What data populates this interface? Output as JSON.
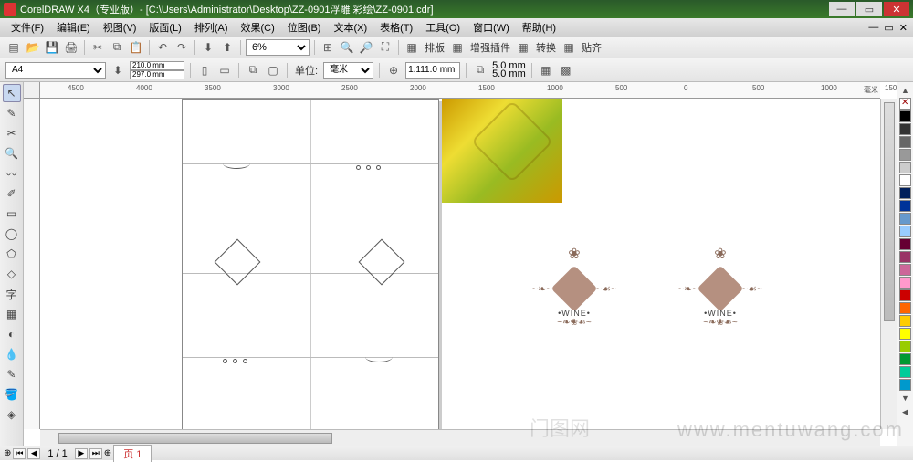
{
  "window": {
    "title": "CorelDRAW X4（专业版）- [C:\\Users\\Administrator\\Desktop\\ZZ-0901浮雕 彩绘\\ZZ-0901.cdr]"
  },
  "menubar": [
    "文件(F)",
    "编辑(E)",
    "视图(V)",
    "版面(L)",
    "排列(A)",
    "效果(C)",
    "位图(B)",
    "文本(X)",
    "表格(T)",
    "工具(O)",
    "窗口(W)",
    "帮助(H)"
  ],
  "toolbar1": {
    "zoom_value": "6%",
    "panel_layout": "排版",
    "panel_plugin": "增强插件",
    "panel_convert": "转换",
    "panel_align": "贴齐"
  },
  "propbar": {
    "paper": "A4",
    "width": "210.0 mm",
    "height": "297.0 mm",
    "units_label": "单位:",
    "units_value": "毫米",
    "nudge": "1.111.0 mm",
    "dup_x": "5.0 mm",
    "dup_y": "5.0 mm"
  },
  "ruler": {
    "units": "毫米",
    "h_ticks": [
      "4500",
      "4000",
      "3500",
      "3000",
      "2500",
      "2000",
      "1500",
      "1000",
      "500",
      "0",
      "500",
      "1000",
      "1500"
    ]
  },
  "canvas_text": {
    "wine1": "•WINE•",
    "wine2": "•WINE•"
  },
  "palette": [
    "none",
    "#000000",
    "#333333",
    "#666666",
    "#999999",
    "#cccccc",
    "#ffffff",
    "#001f5b",
    "#003399",
    "#6699cc",
    "#99ccff",
    "#660033",
    "#993366",
    "#cc6699",
    "#ff99cc",
    "#cc0000",
    "#ff6600",
    "#ffcc00",
    "#ffff00",
    "#99cc00",
    "#009933",
    "#00cc99",
    "#0099cc"
  ],
  "pagenav": {
    "current": "1 / 1",
    "tab": "页 1"
  },
  "watermark": {
    "cn": "门图网",
    "en": "www.mentuwang.com"
  }
}
